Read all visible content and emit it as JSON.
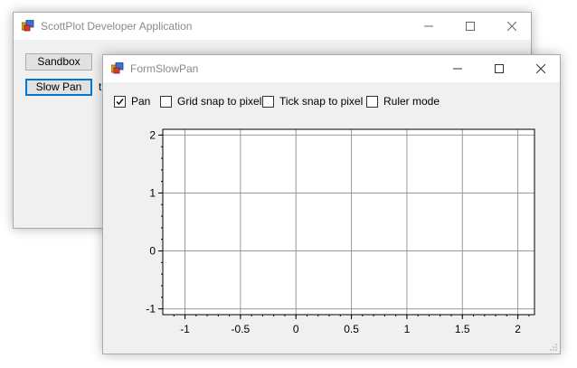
{
  "back_window": {
    "title": "ScottPlot Developer Application",
    "buttons": [
      {
        "label": "Sandbox"
      },
      {
        "label": "Slow Pan"
      }
    ],
    "partial_text": "t"
  },
  "front_window": {
    "title": "FormSlowPan",
    "checkboxes": [
      {
        "label": "Pan",
        "checked": true
      },
      {
        "label": "Grid snap to pixel",
        "checked": false
      },
      {
        "label": "Tick snap to pixel",
        "checked": false
      },
      {
        "label": "Ruler mode",
        "checked": false
      }
    ]
  },
  "chart_data": {
    "type": "line",
    "series": [],
    "xlim": [
      -1.2,
      2.15
    ],
    "ylim": [
      -1.1,
      2.1
    ],
    "x_ticks": [
      -1,
      -0.5,
      0,
      0.5,
      1,
      1.5,
      2
    ],
    "x_tick_labels": [
      "-1",
      "-0.5",
      "0",
      "0.5",
      "1",
      "1.5",
      "2"
    ],
    "y_ticks": [
      -1,
      0,
      1,
      2
    ],
    "y_tick_labels": [
      "-1",
      "0",
      "1",
      "2"
    ],
    "grid": true,
    "background": "#ffffff",
    "grid_color": "#999999"
  },
  "colors": {
    "window_bg": "#f0f0f0",
    "titlebar_bg": "#ffffff",
    "accent": "#0078d7",
    "button_bg": "#e1e1e1"
  }
}
